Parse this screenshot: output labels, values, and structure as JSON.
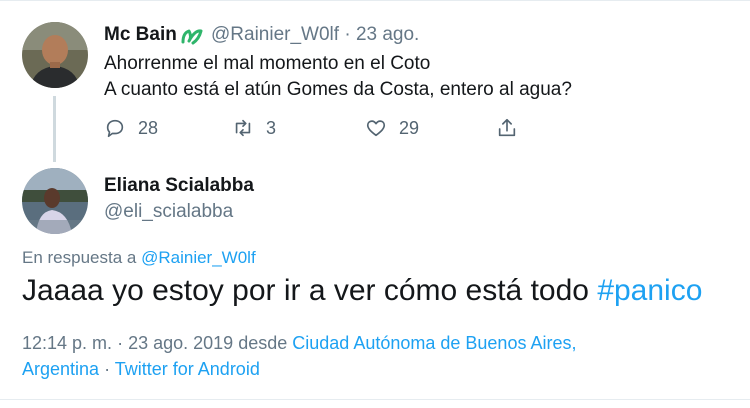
{
  "tweet1": {
    "author_name": "Mc Bain",
    "handle": "@Rainier_W0lf",
    "separator": "·",
    "date": "23 ago.",
    "line1": "Ahorrenme el mal momento en el Coto",
    "line2": "A cuanto está el atún Gomes da Costa, entero al agua?",
    "replies": "28",
    "retweets": "3",
    "likes": "29",
    "icons": [
      "comment-icon",
      "retweet-icon",
      "heart-icon",
      "share-icon"
    ]
  },
  "tweet2": {
    "author_name": "Eliana Scialabba",
    "handle": "@eli_scialabba",
    "reply_prefix": "En respuesta a",
    "reply_to": "@Rainier_W0lf",
    "text": "Jaaaa yo estoy por ir a ver cómo está todo",
    "hashtag": "#panico",
    "time": "12:14 p. m.",
    "date": "23 ago. 2019",
    "from_word": "desde",
    "location_line1": "Ciudad Autónoma de Buenos Aires,",
    "location_line2": "Argentina",
    "client": "Twitter for Android"
  },
  "colors": {
    "link": "#1da1f2",
    "secondary": "#657786",
    "text": "#14171a"
  }
}
